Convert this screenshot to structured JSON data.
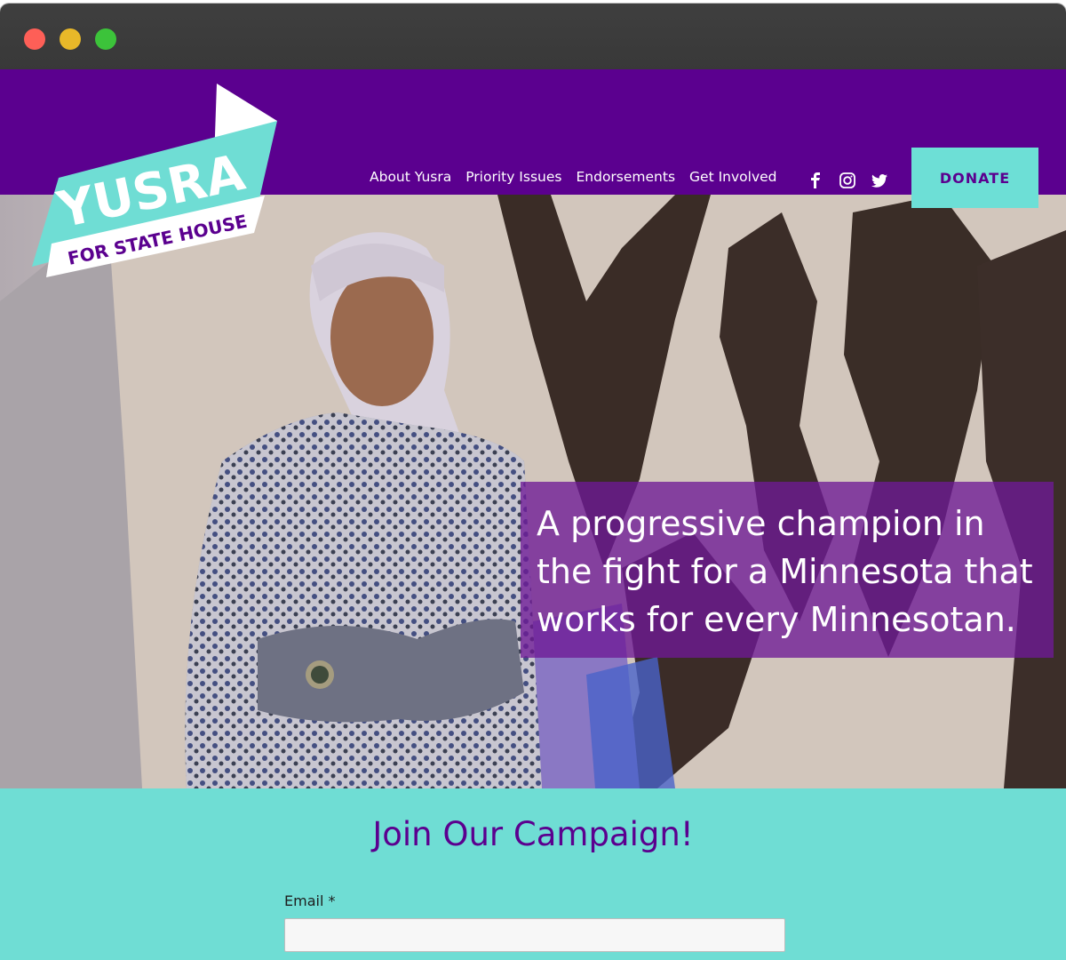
{
  "header": {
    "logo": {
      "name": "YUSRA",
      "subtitle": "FOR STATE HOUSE"
    },
    "nav": [
      {
        "label": "About Yusra"
      },
      {
        "label": "Priority Issues"
      },
      {
        "label": "Endorsements"
      },
      {
        "label": "Get Involved"
      }
    ],
    "social_icons": [
      "facebook-icon",
      "instagram-icon",
      "twitter-icon"
    ],
    "donate_label": "DONATE"
  },
  "hero": {
    "tagline": "A progressive champion in the fight for a Minnesota that works for every Minnesotan."
  },
  "join": {
    "title": "Join Our Campaign!",
    "email_label": "Email *",
    "email_value": "",
    "email_placeholder": ""
  },
  "colors": {
    "brand_purple": "#5b008f",
    "brand_teal": "#6fddd4",
    "tagline_overlay": "#6e1996"
  }
}
